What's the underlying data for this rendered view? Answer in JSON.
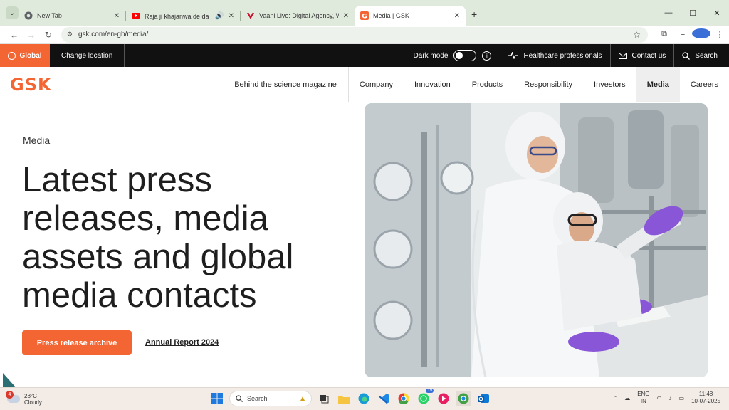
{
  "browser": {
    "tabs": [
      {
        "title": "New Tab",
        "icon": "chrome-icon",
        "color": "#5f6368",
        "active": false,
        "audio": false
      },
      {
        "title": "Raja ji khajanwa de da | राज",
        "icon": "youtube-icon",
        "color": "#ff0000",
        "active": false,
        "audio": true
      },
      {
        "title": "Vaani Live: Digital Agency, Web",
        "icon": "vaani-icon",
        "color": "#c8102e",
        "active": false,
        "audio": false
      },
      {
        "title": "Media | GSK",
        "icon": "gsk-icon",
        "color": "#f36633",
        "active": true,
        "audio": false
      }
    ],
    "url": "gsk.com/en-gb/media/"
  },
  "site": {
    "util": {
      "global_label": "Global",
      "change_location": "Change location",
      "dark_mode": "Dark mode",
      "healthcare": "Healthcare professionals",
      "contact": "Contact us",
      "search": "Search"
    },
    "logo_text": "GSK",
    "nav": [
      "Behind the science magazine",
      "Company",
      "Innovation",
      "Products",
      "Responsibility",
      "Investors",
      "Media",
      "Careers"
    ],
    "active_nav": "Media"
  },
  "hero": {
    "eyebrow": "Media",
    "title": "Latest press releases, media assets and global media contacts",
    "primary_button": "Press release archive",
    "secondary_link": "Annual Report 2024",
    "image_alt": "Scientists in white protective suits and purple gloves working in a lab"
  },
  "taskbar": {
    "weather_temp": "28°C",
    "weather_desc": "Cloudy",
    "weather_badge": "4",
    "search_placeholder": "Search",
    "whatsapp_badge": "19",
    "lang_1": "ENG",
    "lang_2": "IN",
    "time": "11:48",
    "date": "10-07-2025"
  },
  "colors": {
    "brand_orange": "#f36633",
    "utility_bar": "#111111",
    "tabstrip": "#dfe9dc"
  }
}
